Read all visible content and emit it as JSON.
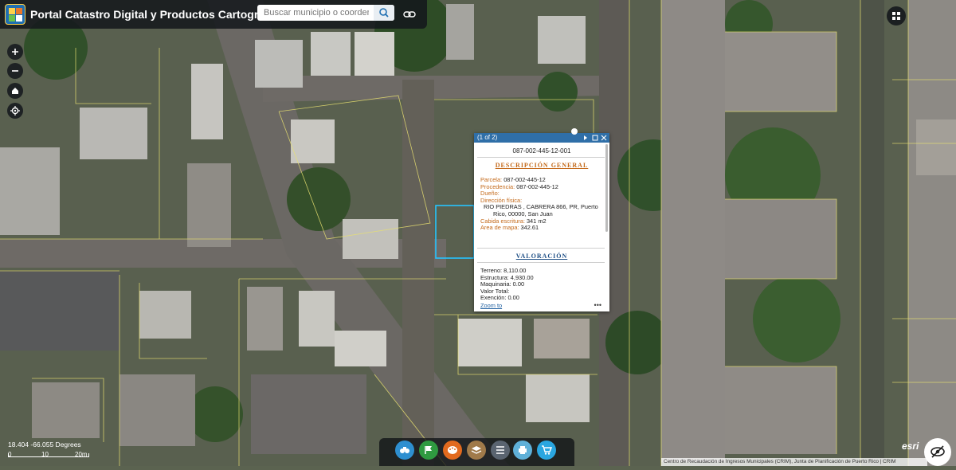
{
  "app": {
    "title": "Portal Catastro Digital y Productos Cartográficos",
    "search_placeholder": "Buscar municipio o coordenada"
  },
  "popup": {
    "pager": "(1 of 2)",
    "parcel_id": "087-002-445-12-001",
    "section1_title": "DESCRIPCIÓN GENERAL",
    "fields": {
      "parcela_label": "Parcela:",
      "parcela_value": "087-002-445-12",
      "procedencia_label": "Procedencia:",
      "procedencia_value": "087-002-445-12",
      "dueno_label": "Dueño:",
      "direccion_label": "Dirección física:",
      "direccion_line1": "RIO PIEDRAS , CABRERA 866, PR, Puerto",
      "direccion_line2": "Rico, 00000, San Juan",
      "cabida_label": "Cabida escritura:",
      "cabida_value": "341 m2",
      "area_label": "Area de mapa:",
      "area_value": "342.61"
    },
    "section2_title": "VALORACIÓN",
    "valoracion": {
      "terreno": "Terreno: 8,110.00",
      "estructura": "Estructura: 4,930.00",
      "maquinaria": "Maquinaria: 0.00",
      "valor_total": "Valor Total:",
      "exencion": "Exención: 0.00"
    },
    "zoom_link": "Zoom to",
    "more": "•••"
  },
  "status": {
    "coordinates": "18.404 -66.055 Degrees",
    "scale_left": "0",
    "scale_mid": "10",
    "scale_right": "20m"
  },
  "attribution": "Centro de Recaudación de Ingresos Municipales (CRIM), Junta de Planificación de Puerto Rico | CRIM",
  "esri_logo": "esri",
  "toolbar_icons": [
    "binoculars-icon",
    "flag-icon",
    "palette-icon",
    "layers-icon",
    "list-icon",
    "print-icon",
    "cart-icon"
  ],
  "colors": {
    "header_bg": "#14181c",
    "popup_header": "#2f6fa8",
    "field_label": "#c46a1b",
    "selection": "#27c3ff",
    "parcel_lines": "#e8e070"
  }
}
